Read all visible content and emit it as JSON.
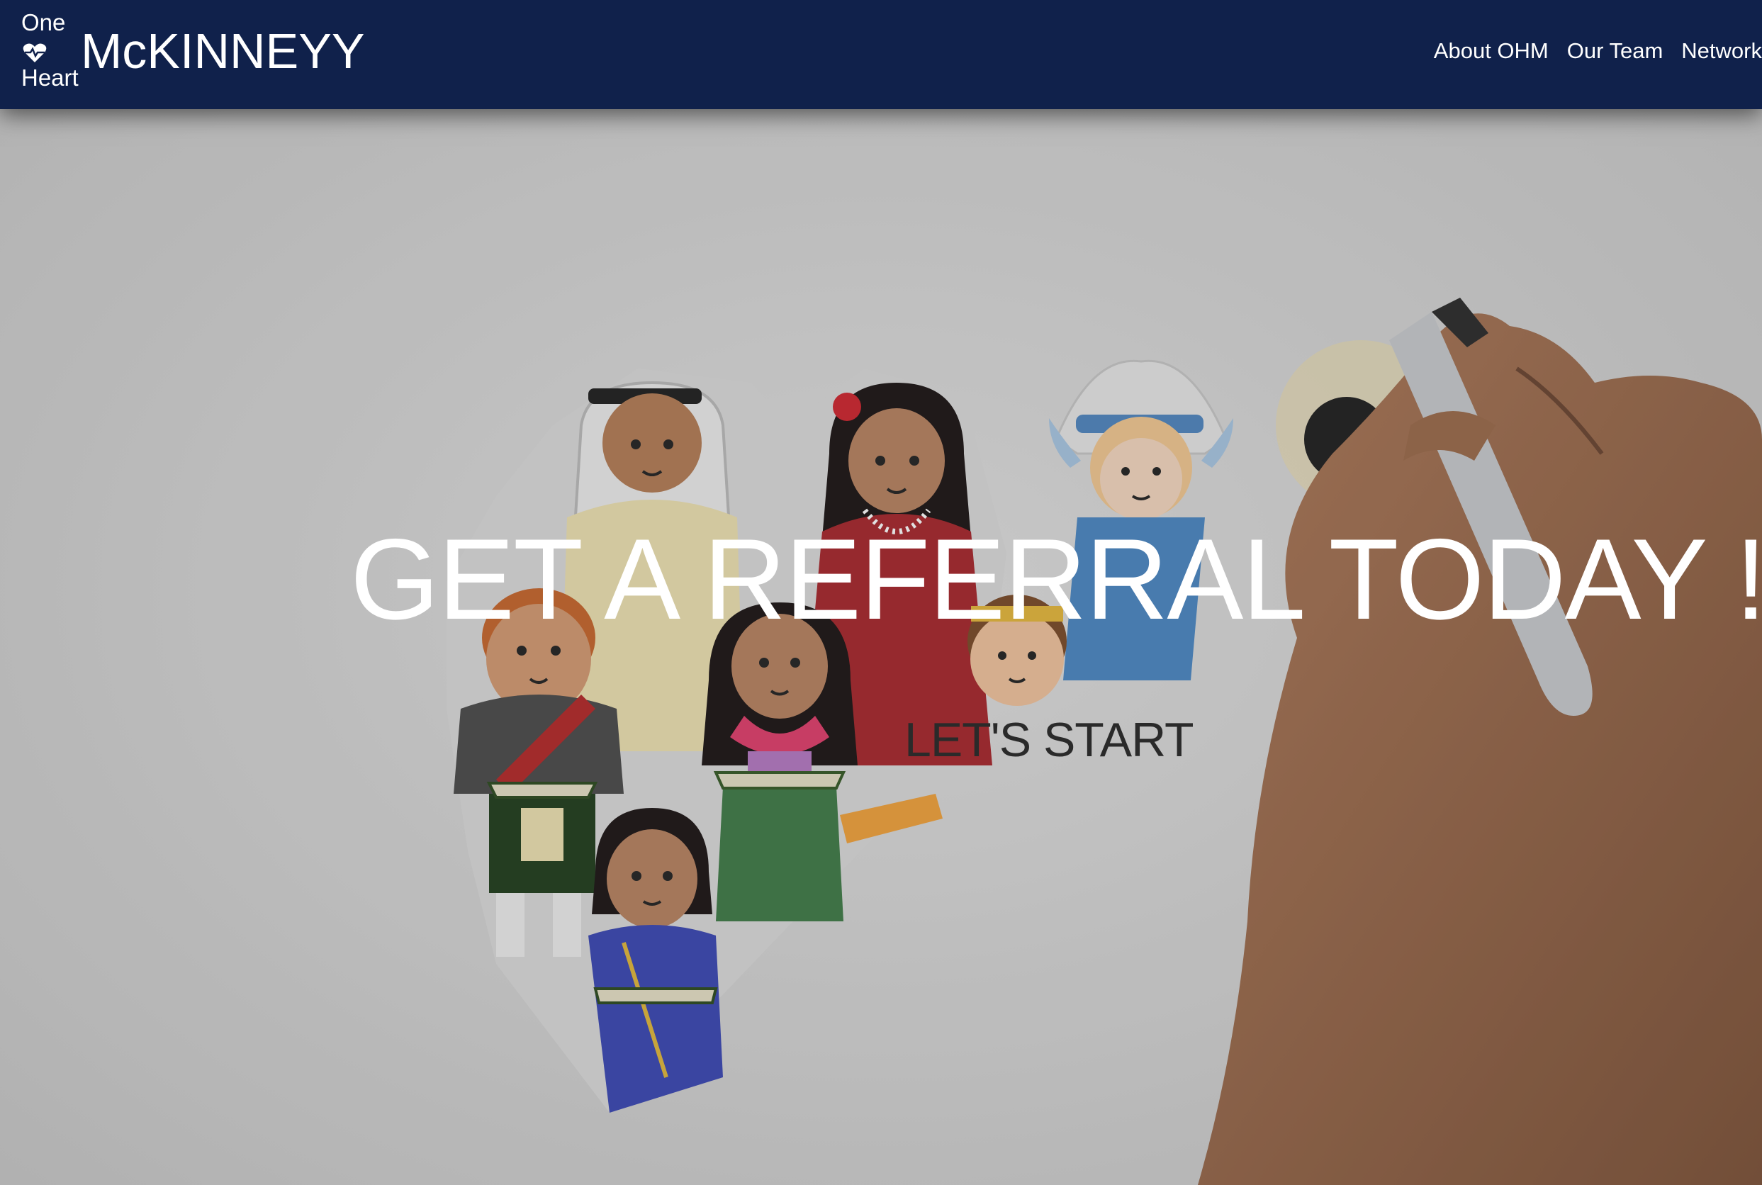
{
  "brand": {
    "line1": "One",
    "line2": "Heart",
    "name": "McKINNEYY",
    "icon": "heart-pulse-icon"
  },
  "nav": {
    "items": [
      {
        "label": "About OHM"
      },
      {
        "label": "Our Team"
      },
      {
        "label": "Network"
      }
    ]
  },
  "hero": {
    "headline": "GET A REFERRAL TODAY !",
    "cta_label": "LET'S START",
    "background": "whiteboard-illustration-children-heart-hand-marker"
  },
  "colors": {
    "navbar": "#10214b",
    "headline": "#ffffff",
    "cta": "#2a2a2a",
    "background": "#d2d2d2"
  }
}
